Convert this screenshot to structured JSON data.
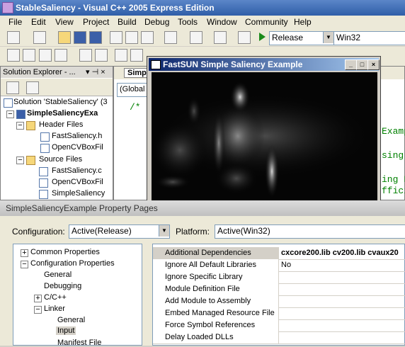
{
  "app": {
    "title": "StableSaliency - Visual C++ 2005 Express Edition"
  },
  "menu": [
    "File",
    "Edit",
    "View",
    "Project",
    "Build",
    "Debug",
    "Tools",
    "Window",
    "Community",
    "Help"
  ],
  "toolbar": {
    "config": "Release",
    "platform": "Win32"
  },
  "solution_explorer": {
    "header": "Solution Explorer - ...",
    "items": [
      "Solution 'StableSaliency' (3",
      "SimpleSaliencyExa",
      "Header Files",
      "FastSaliency.h",
      "OpenCVBoxFil",
      "Source Files",
      "FastSaliency.c",
      "OpenCVBoxFil",
      "SimpleSaliency"
    ]
  },
  "editor": {
    "tab": "Simpl",
    "scope": "(Global S",
    "code_lines": [
      "/*",
      "Examp",
      "sing",
      "ing F",
      "ffici"
    ]
  },
  "image_window": {
    "title": "FastSUN Simple Saliency Example"
  },
  "property_pages": {
    "title": "SimpleSaliencyExample Property Pages",
    "configuration_label": "Configuration:",
    "configuration_value": "Active(Release)",
    "platform_label": "Platform:",
    "platform_value": "Active(Win32)",
    "tree": [
      "Common Properties",
      "Configuration Properties",
      "General",
      "Debugging",
      "C/C++",
      "Linker",
      "General",
      "Input",
      "Manifest File"
    ],
    "grid": [
      {
        "key": "Additional Dependencies",
        "value": "cxcore200.lib cv200.lib cvaux20"
      },
      {
        "key": "Ignore All Default Libraries",
        "value": "No"
      },
      {
        "key": "Ignore Specific Library",
        "value": ""
      },
      {
        "key": "Module Definition File",
        "value": ""
      },
      {
        "key": "Add Module to Assembly",
        "value": ""
      },
      {
        "key": "Embed Managed Resource File",
        "value": ""
      },
      {
        "key": "Force Symbol References",
        "value": ""
      },
      {
        "key": "Delay Loaded DLLs",
        "value": ""
      }
    ]
  }
}
